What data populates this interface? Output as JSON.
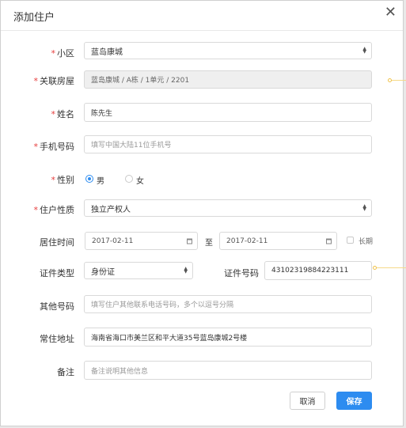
{
  "dialog": {
    "title": "添加住户",
    "close_glyph": "✕"
  },
  "form": {
    "community": {
      "label": "小区",
      "value": "蓝岛康城"
    },
    "room": {
      "label": "关联房屋",
      "value": "蓝岛康城 / A栋 / 1单元 / 2201"
    },
    "name": {
      "label": "姓名",
      "value": "陈先生"
    },
    "phone": {
      "label": "手机号码",
      "placeholder": "填写中国大陆11位手机号"
    },
    "gender": {
      "label": "性别",
      "options": [
        "男",
        "女"
      ],
      "selected": "男"
    },
    "nature": {
      "label": "住户性质",
      "value": "独立产权人"
    },
    "residence": {
      "label": "居住时间",
      "from": "2017-02-11",
      "separator": "至",
      "to": "2017-02-11",
      "long_term": "长期"
    },
    "id_type": {
      "label": "证件类型",
      "value": "身份证"
    },
    "id_number": {
      "label": "证件号码",
      "value": "43102319884223111"
    },
    "other_phone": {
      "label": "其他号码",
      "placeholder": "填写住户其他联系电话号码，多个以逗号分隔"
    },
    "address": {
      "label": "常住地址",
      "value": "海南省海口市美兰区和平大道35号蓝岛康城2号楼"
    },
    "remark": {
      "label": "备注",
      "placeholder": "备注说明其他信息"
    },
    "required_mark": "*"
  },
  "buttons": {
    "cancel": "取消",
    "save": "保存"
  },
  "colors": {
    "accent": "#2d8cf0",
    "required": "#e63c3c"
  }
}
